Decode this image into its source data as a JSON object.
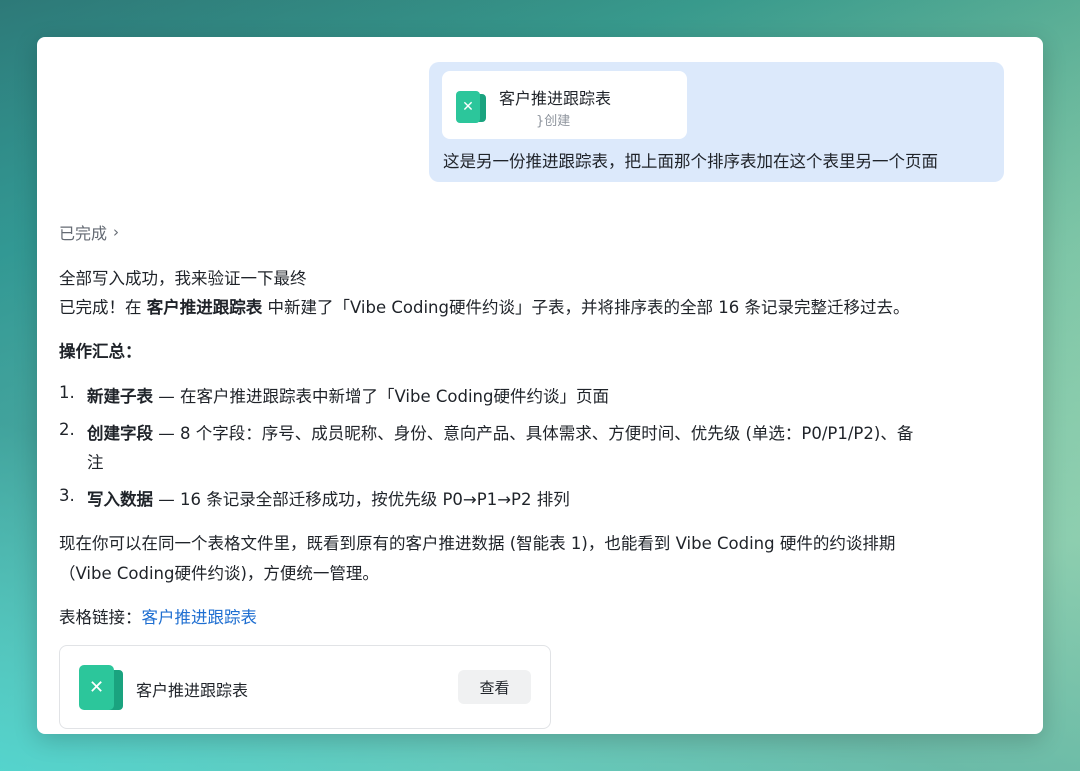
{
  "user_message": {
    "attachment": {
      "icon": "spreadsheet-icon",
      "title": "客户推进跟踪表",
      "subtitle": "}创建"
    },
    "text": "这是另一份推进跟踪表，把上面那个排序表加在这个表里另一个页面"
  },
  "assistant": {
    "status_label": "已完成",
    "intro_line": "全部写入成功，我来验证一下最终",
    "summary": {
      "prefix": "已完成！在 ",
      "file_name": "客户推进跟踪表",
      "suffix": " 中新建了「Vibe Coding硬件约谈」子表，并将排序表的全部 16 条记录完整迁移过去。"
    },
    "section_title": "操作汇总：",
    "steps": [
      {
        "num": "1.",
        "title": "新建子表",
        "text": " — 在客户推进跟踪表中新增了「Vibe Coding硬件约谈」页面"
      },
      {
        "num": "2.",
        "title": "创建字段",
        "text": " — 8 个字段：序号、成员昵称、身份、意向产品、具体需求、方便时间、优先级 (单选：P0/P1/P2)、备",
        "text_cont": "注"
      },
      {
        "num": "3.",
        "title": "写入数据",
        "text": " — 16 条记录全部迁移成功，按优先级 P0→P1→P2 排列"
      }
    ],
    "closing_line1": "现在你可以在同一个表格文件里，既看到原有的客户推进数据 (智能表 1)，也能看到 Vibe Coding 硬件的约谈排期",
    "closing_line2": "（Vibe Coding硬件约谈)，方便统一管理。",
    "link_label": "表格链接：",
    "link_text": "客户推进跟踪表",
    "link_card": {
      "icon": "spreadsheet-icon",
      "title": "客户推进跟踪表",
      "button_label": "查看"
    }
  }
}
